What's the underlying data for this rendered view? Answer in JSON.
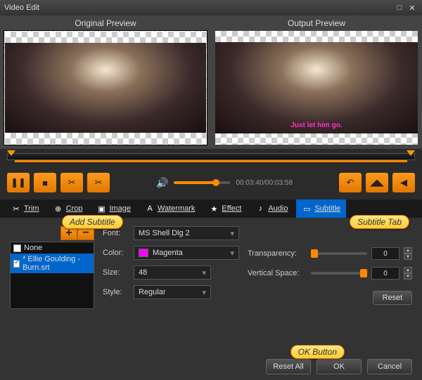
{
  "window": {
    "title": "Video Edit"
  },
  "previews": {
    "left_label": "Original Preview",
    "right_label": "Output Preview",
    "subtitle_text": "Just let him go."
  },
  "transport": {
    "time": "00:03:40/00:03:58"
  },
  "tabs": {
    "trim": "Trim",
    "crop": "Crop",
    "image": "Image",
    "watermark": "Watermark",
    "effect": "Effect",
    "audio": "Audio",
    "subtitle": "Subtitle"
  },
  "subtitle_panel": {
    "list": {
      "none": "None",
      "file": "* Ellie Goulding - Burn.srt"
    },
    "font_label": "Font:",
    "font_value": "MS Shell Dlg 2",
    "color_label": "Color:",
    "color_value": "Magenta",
    "size_label": "Size:",
    "size_value": "48",
    "style_label": "Style:",
    "style_value": "Regular",
    "transparency_label": "Transparency:",
    "transparency_value": "0",
    "vspace_label": "Vertical Space:",
    "vspace_value": "0",
    "reset": "Reset"
  },
  "footer": {
    "reset_all": "Reset All",
    "ok": "OK",
    "cancel": "Cancel"
  },
  "callouts": {
    "add_subtitle": "Add Subtitle",
    "subtitle_tab": "Subtitle Tab",
    "ok_button": "OK Button"
  }
}
